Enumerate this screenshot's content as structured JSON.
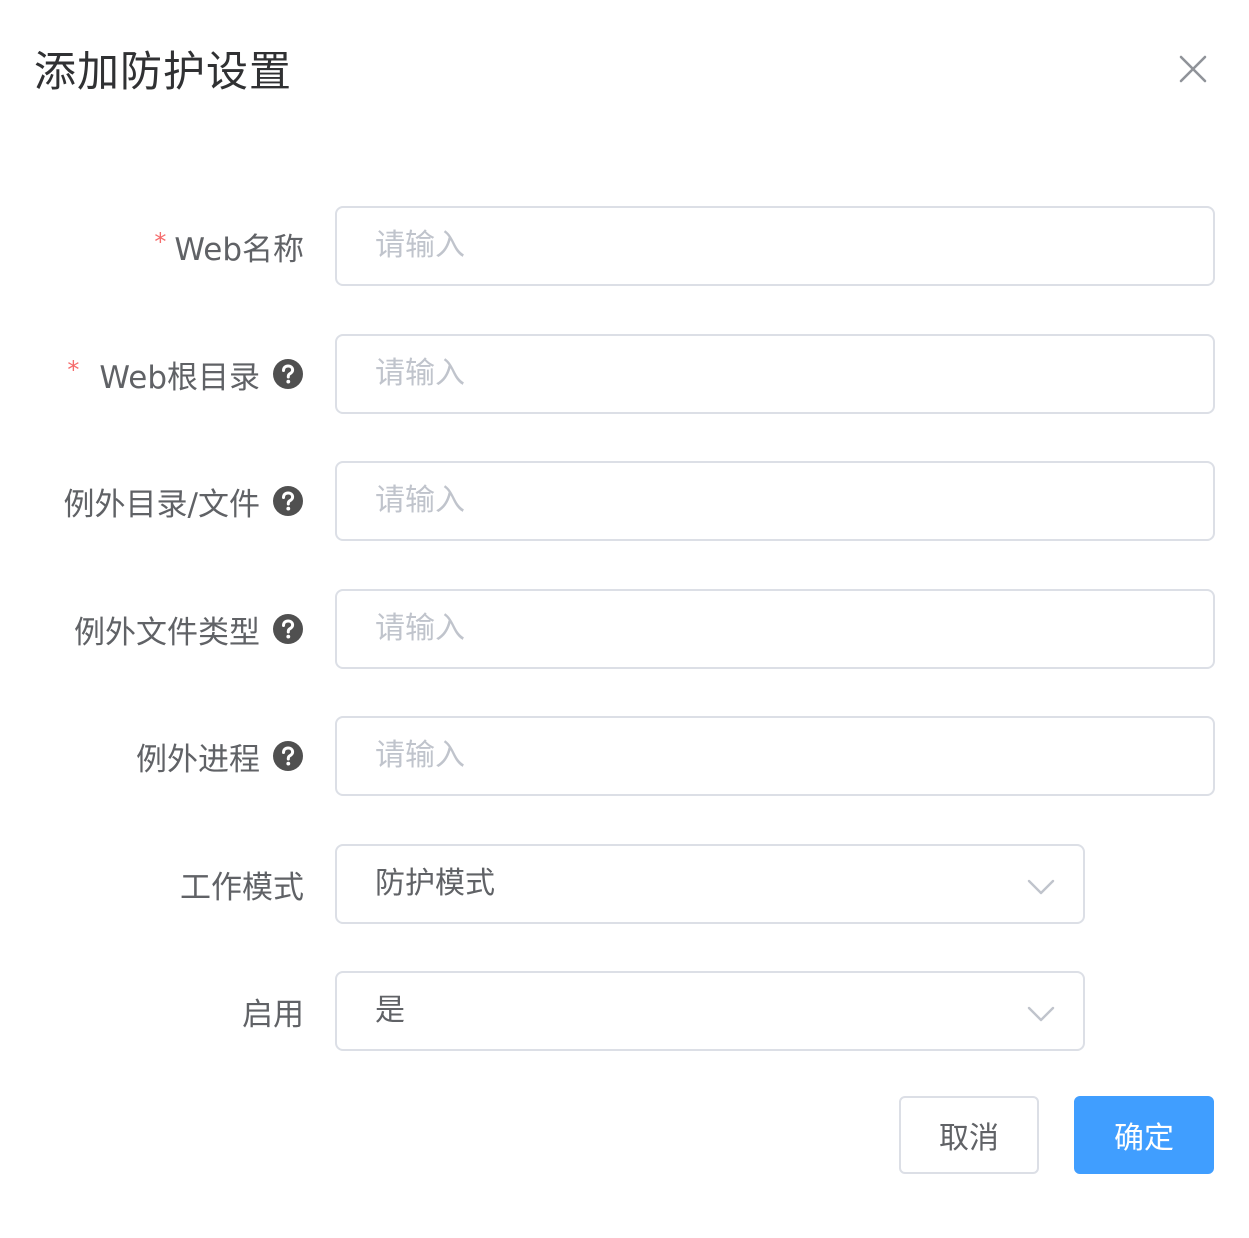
{
  "dialog": {
    "title": "添加防护设置"
  },
  "form": {
    "fields": [
      {
        "label": "Web名称",
        "required": true,
        "help": false,
        "placeholder": "请输入",
        "type": "input"
      },
      {
        "label": "Web根目录",
        "required": true,
        "help": true,
        "placeholder": "请输入",
        "type": "input"
      },
      {
        "label": "例外目录/文件",
        "required": false,
        "help": true,
        "placeholder": "请输入",
        "type": "input"
      },
      {
        "label": "例外文件类型",
        "required": false,
        "help": true,
        "placeholder": "请输入",
        "type": "input"
      },
      {
        "label": "例外进程",
        "required": false,
        "help": true,
        "placeholder": "请输入",
        "type": "input"
      },
      {
        "label": "工作模式",
        "required": false,
        "help": false,
        "value": "防护模式",
        "type": "select"
      },
      {
        "label": "启用",
        "required": false,
        "help": false,
        "value": "是",
        "type": "select"
      }
    ],
    "required_marker": "*"
  },
  "footer": {
    "cancel_label": "取消",
    "confirm_label": "确定"
  },
  "colors": {
    "primary": "#409eff",
    "required": "#f56c6c",
    "border": "#dcdfe6",
    "placeholder": "#c0c4cc",
    "label": "#606266"
  },
  "icons": {
    "close": "close-icon",
    "help": "question-circle-icon",
    "select_arrow": "chevron-down-icon"
  }
}
